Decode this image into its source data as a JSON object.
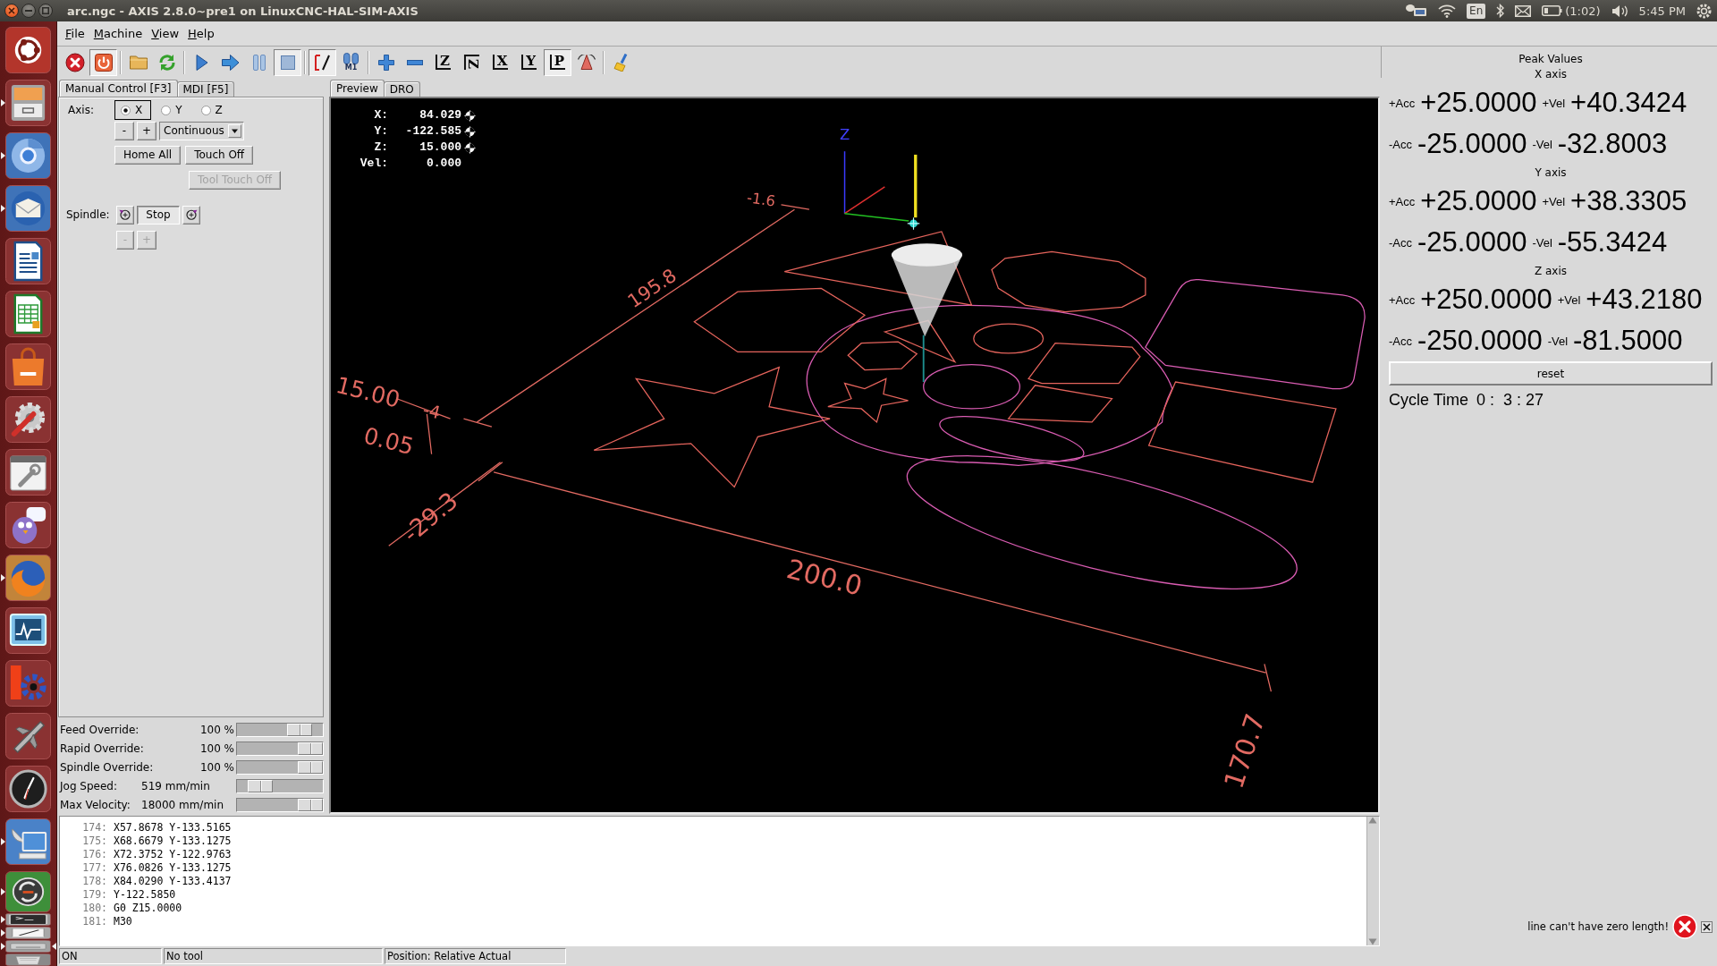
{
  "top_panel": {
    "title": "arc.ngc - AXIS 2.8.0~pre1 on LinuxCNC-HAL-SIM-AXIS",
    "keyboard": "En",
    "battery": "(1:02)",
    "clock": "5:45 PM"
  },
  "launcher": [
    {
      "kind": "home",
      "running": false,
      "focused": false
    },
    {
      "kind": "files",
      "running": true,
      "focused": false
    },
    {
      "kind": "browser",
      "running": true,
      "focused": false
    },
    {
      "kind": "mail",
      "running": true,
      "focused": false
    },
    {
      "kind": "writer",
      "running": false,
      "focused": false
    },
    {
      "kind": "calc",
      "running": false,
      "focused": false
    },
    {
      "kind": "store",
      "running": false,
      "focused": false
    },
    {
      "kind": "settings",
      "running": false,
      "focused": false
    },
    {
      "kind": "tools",
      "running": false,
      "focused": false
    },
    {
      "kind": "chat",
      "running": false,
      "focused": false
    },
    {
      "kind": "firefox",
      "running": true,
      "focused": false
    },
    {
      "kind": "monitor",
      "running": false,
      "focused": false
    },
    {
      "kind": "cog",
      "running": false,
      "focused": false
    },
    {
      "kind": "jet",
      "running": false,
      "focused": false
    },
    {
      "kind": "clock",
      "running": false,
      "focused": false
    },
    {
      "kind": "remote",
      "running": true,
      "focused": false
    },
    {
      "kind": "update",
      "running": true,
      "focused": false
    },
    {
      "kind": "terminal",
      "running": true,
      "focused": false
    },
    {
      "kind": "editor",
      "running": true,
      "focused": false
    },
    {
      "kind": "drive",
      "running": true,
      "focused": true
    },
    {
      "kind": "trash",
      "running": false,
      "focused": false
    }
  ],
  "menu": [
    "File",
    "Machine",
    "View",
    "Help"
  ],
  "toolbar": [
    [
      {
        "kind": "estop",
        "pressed": false
      },
      {
        "kind": "power",
        "pressed": true
      }
    ],
    [
      {
        "kind": "open",
        "pressed": false
      },
      {
        "kind": "reload",
        "pressed": false
      }
    ],
    [
      {
        "kind": "run",
        "pressed": false
      },
      {
        "kind": "step",
        "pressed": false
      },
      {
        "kind": "pause",
        "pressed": false
      },
      {
        "kind": "stop",
        "pressed": true
      }
    ],
    [
      {
        "kind": "skip",
        "pressed": true
      },
      {
        "kind": "optstop",
        "label": "M1",
        "pressed": false
      }
    ],
    [
      {
        "kind": "zoomin",
        "pressed": false
      },
      {
        "kind": "zoomout",
        "pressed": false
      },
      {
        "kind": "view",
        "label": "Z",
        "pressed": false
      },
      {
        "kind": "turnedview",
        "label": "Z",
        "pressed": false
      },
      {
        "kind": "view",
        "label": "X",
        "pressed": false
      },
      {
        "kind": "view",
        "label": "Y",
        "pressed": false
      },
      {
        "kind": "view",
        "label": "P",
        "pressed": true
      },
      {
        "kind": "cone",
        "pressed": false
      }
    ],
    [
      {
        "kind": "clear",
        "pressed": false
      }
    ]
  ],
  "left_tabs": [
    {
      "label": "Manual Control [F3]",
      "selected": true
    },
    {
      "label": "MDI [F5]",
      "selected": false
    }
  ],
  "manual": {
    "axis_label": "Axis:",
    "axes": [
      {
        "label": "X",
        "selected": true
      },
      {
        "label": "Y",
        "selected": false
      },
      {
        "label": "Z",
        "selected": false
      }
    ],
    "jog": [
      {
        "label": "-",
        "disabled": false
      },
      {
        "label": "+",
        "disabled": false
      }
    ],
    "increment": "Continuous",
    "actions": [
      {
        "label": "Home All",
        "disabled": false
      },
      {
        "label": "Touch Off",
        "disabled": false
      }
    ],
    "tool_touch_off": {
      "label": "Tool Touch Off",
      "disabled": true
    },
    "spindle_label": "Spindle:",
    "spindle": [
      {
        "kind": "reverse",
        "selected": false
      },
      {
        "kind": "stop",
        "label": "Stop",
        "selected": true
      },
      {
        "kind": "forward",
        "selected": false
      }
    ],
    "spindle_speed": [
      {
        "label": "-",
        "disabled": true
      },
      {
        "label": "+",
        "disabled": true
      }
    ]
  },
  "overrides": [
    {
      "kind": "percent",
      "label": "Feed Override:",
      "value": "100 %",
      "level": 0.83
    },
    {
      "kind": "percent",
      "label": "Rapid Override:",
      "value": "100 %",
      "level": 1
    },
    {
      "kind": "percent",
      "label": "Spindle Override:",
      "value": "100 %",
      "level": 1
    },
    {
      "kind": "rate",
      "label": "Jog Speed:",
      "value": "519 mm/min",
      "level": 0.17
    },
    {
      "kind": "rate",
      "label": "Max Velocity:",
      "value": "18000 mm/min",
      "level": 1
    }
  ],
  "preview_tabs": [
    {
      "label": "Preview",
      "selected": true
    },
    {
      "label": "DRO",
      "selected": false
    }
  ],
  "dro": [
    {
      "axis": "X:",
      "value": "84.029",
      "homed": true
    },
    {
      "axis": "Y:",
      "value": "-122.585",
      "homed": true
    },
    {
      "axis": "Z:",
      "value": "15.000",
      "homed": true
    },
    {
      "axis": "Vel:",
      "value": "0.000"
    }
  ],
  "preview": {
    "axis_label": "Z",
    "dimension_labels": [
      "-1.6",
      "195.8",
      "15.00",
      "-4",
      "0.05",
      "-29.3",
      "200.0",
      "170.7"
    ]
  },
  "code": [
    {
      "number": "174:",
      "text": "X57.8678 Y-133.5165"
    },
    {
      "number": "175:",
      "text": "X68.6679 Y-133.1275"
    },
    {
      "number": "176:",
      "text": "X72.3752 Y-122.9763"
    },
    {
      "number": "177:",
      "text": "X76.0826 Y-133.1275"
    },
    {
      "number": "178:",
      "text": "X84.0290 Y-133.4137"
    },
    {
      "number": "179:",
      "text": "Y-122.5850"
    },
    {
      "number": "180:",
      "text": "G0 Z15.0000"
    },
    {
      "number": "181:",
      "text": "M30"
    }
  ],
  "status_bar": [
    "ON",
    "No tool",
    "Position: Relative Actual"
  ],
  "peak": {
    "title": "Peak Values",
    "axes": [
      {
        "name": "X axis",
        "rows": [
          {
            "acc_label": "+Acc",
            "acc": "+25.0000",
            "vel_label": "+Vel",
            "vel": "+40.3424"
          },
          {
            "acc_label": "-Acc",
            "acc": "-25.0000",
            "vel_label": "-Vel",
            "vel": "-32.8003"
          }
        ]
      },
      {
        "name": "Y axis",
        "rows": [
          {
            "acc_label": "+Acc",
            "acc": "+25.0000",
            "vel_label": "+Vel",
            "vel": "+38.3305"
          },
          {
            "acc_label": "-Acc",
            "acc": "-25.0000",
            "vel_label": "-Vel",
            "vel": "-55.3424"
          }
        ]
      },
      {
        "name": "Z axis",
        "rows": [
          {
            "acc_label": "+Acc",
            "acc": "+250.0000",
            "vel_label": "+Vel",
            "vel": "+43.2180"
          },
          {
            "acc_label": "-Acc",
            "acc": "-250.0000",
            "vel_label": "-Vel",
            "vel": "-81.5000"
          }
        ]
      }
    ],
    "reset": "reset"
  },
  "cycle_time": {
    "label": "Cycle Time",
    "value": "0 :  3 : 27"
  },
  "notification": {
    "message": "line can't have zero length!"
  }
}
